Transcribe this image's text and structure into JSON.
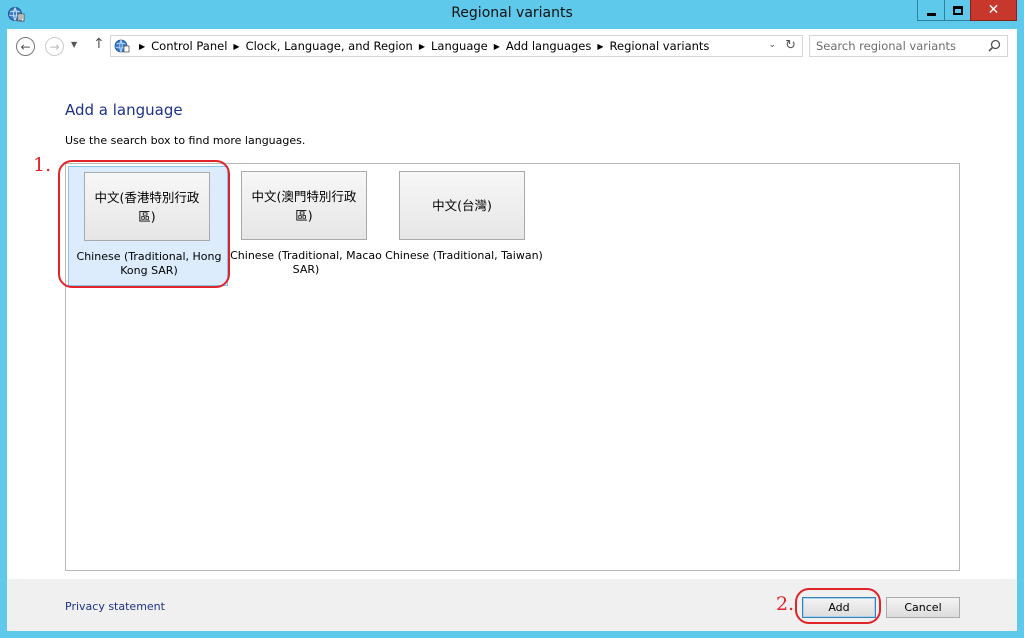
{
  "window": {
    "title": "Regional variants",
    "close_glyph": "✕",
    "accent_color": "#5ec9ea",
    "close_color": "#c7372b"
  },
  "nav": {
    "back_glyph": "←",
    "forward_glyph": "→",
    "dropdown_glyph": "▼",
    "up_glyph": "↑",
    "breadcrumbs": [
      "Control Panel",
      "Clock, Language, and Region",
      "Language",
      "Add languages",
      "Regional variants"
    ],
    "breadcrumb_sep": "▶",
    "address_dropdown_glyph": "⌄",
    "refresh_glyph": "↻",
    "search_placeholder": "Search regional variants"
  },
  "main": {
    "heading": "Add a language",
    "hint": "Use the search box to find more languages.",
    "languages": [
      {
        "native": "中文(香港特別行政區)",
        "english": "Chinese (Traditional, Hong Kong SAR)",
        "selected": true
      },
      {
        "native": "中文(澳門特別行政區)",
        "english": "Chinese (Traditional, Macao SAR)",
        "selected": false
      },
      {
        "native": "中文(台灣)",
        "english": "Chinese (Traditional, Taiwan)",
        "selected": false
      }
    ]
  },
  "footer": {
    "privacy_link": "Privacy statement",
    "add_label": "Add",
    "cancel_label": "Cancel"
  },
  "annotations": {
    "step1": "1.",
    "step2": "2.",
    "color": "#e0242a"
  }
}
